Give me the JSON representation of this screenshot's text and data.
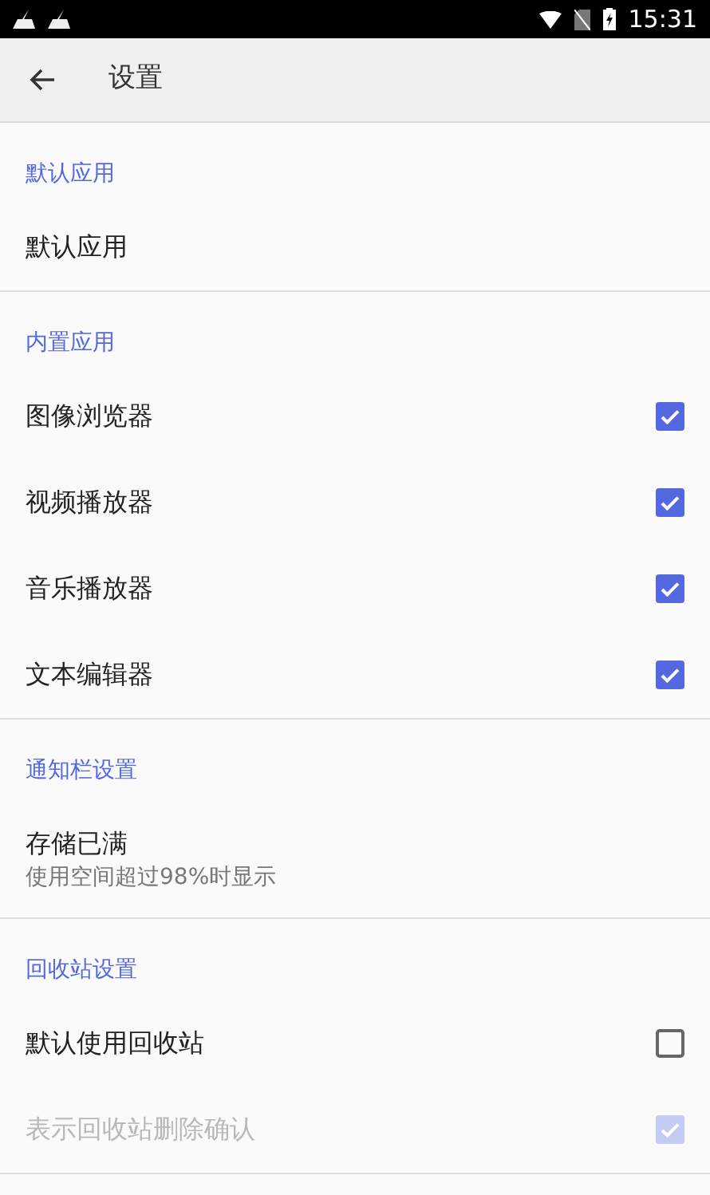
{
  "status_bar": {
    "time": "15:31"
  },
  "app_bar": {
    "title": "设置"
  },
  "sections": [
    {
      "header": "默认应用",
      "items": [
        {
          "kind": "plain",
          "label": "默认应用",
          "disabled": false
        }
      ]
    },
    {
      "header": "内置应用",
      "items": [
        {
          "kind": "checkbox",
          "label": "图像浏览器",
          "checked": true,
          "disabled": false
        },
        {
          "kind": "checkbox",
          "label": "视频播放器",
          "checked": true,
          "disabled": false
        },
        {
          "kind": "checkbox",
          "label": "音乐播放器",
          "checked": true,
          "disabled": false
        },
        {
          "kind": "checkbox",
          "label": "文本编辑器",
          "checked": true,
          "disabled": false
        }
      ]
    },
    {
      "header": "通知栏设置",
      "items": [
        {
          "kind": "plain",
          "label": "存储已满",
          "summary": "使用空间超过98%时显示",
          "disabled": false
        }
      ]
    },
    {
      "header": "回收站设置",
      "items": [
        {
          "kind": "checkbox",
          "label": "默认使用回收站",
          "checked": false,
          "disabled": false
        },
        {
          "kind": "checkbox",
          "label": "表示回收站删除确认",
          "checked": true,
          "disabled": true
        }
      ]
    }
  ]
}
